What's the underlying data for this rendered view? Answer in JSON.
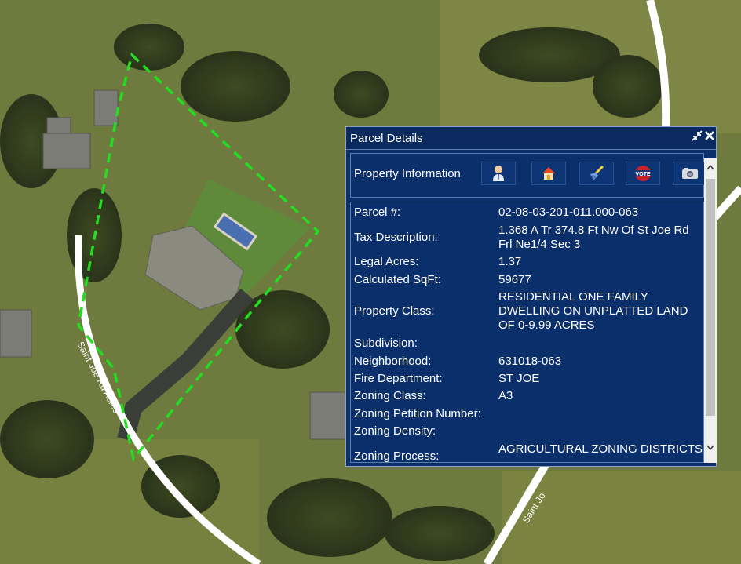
{
  "map": {
    "road_labels": [
      "Saint Joe Rd Acres",
      "Saint Jo"
    ]
  },
  "panel": {
    "title": "Parcel Details",
    "collapse_icon": "collapse-arrows-icon",
    "close_icon": "close-icon",
    "section_label": "Property Information",
    "tools": [
      {
        "icon": "owner-person-icon"
      },
      {
        "icon": "house-icon"
      },
      {
        "icon": "broom-icon"
      },
      {
        "icon": "vote-icon",
        "text": "VOTE"
      },
      {
        "icon": "camera-icon"
      }
    ],
    "fields": [
      {
        "label": "Parcel #:",
        "value": "02-08-03-201-011.000-063"
      },
      {
        "label": "Tax Description:",
        "value": "1.368 A Tr 374.8 Ft Nw Of St Joe Rd Frl Ne1/4 Sec 3"
      },
      {
        "label": "Legal Acres:",
        "value": "1.37"
      },
      {
        "label": "Calculated SqFt:",
        "value": "59677"
      },
      {
        "label": "Property Class:",
        "value": "RESIDENTIAL ONE FAMILY DWELLING ON UNPLATTED LAND OF 0-9.99 ACRES"
      },
      {
        "label": "Subdivision:",
        "value": ""
      },
      {
        "label": "Neighborhood:",
        "value": "631018-063"
      },
      {
        "label": "Fire Department:",
        "value": "ST JOE"
      },
      {
        "label": "Zoning Class:",
        "value": "A3"
      },
      {
        "label": "Zoning Petition Number:",
        "value": ""
      },
      {
        "label": "Zoning Density:",
        "value": ""
      },
      {
        "label": "Zoning Process:",
        "value": "AGRICULTURAL ZONING DISTRICTS"
      }
    ]
  },
  "colors": {
    "panel_bg": "#0b2f6b",
    "parcel_outline": "#22dd22"
  }
}
